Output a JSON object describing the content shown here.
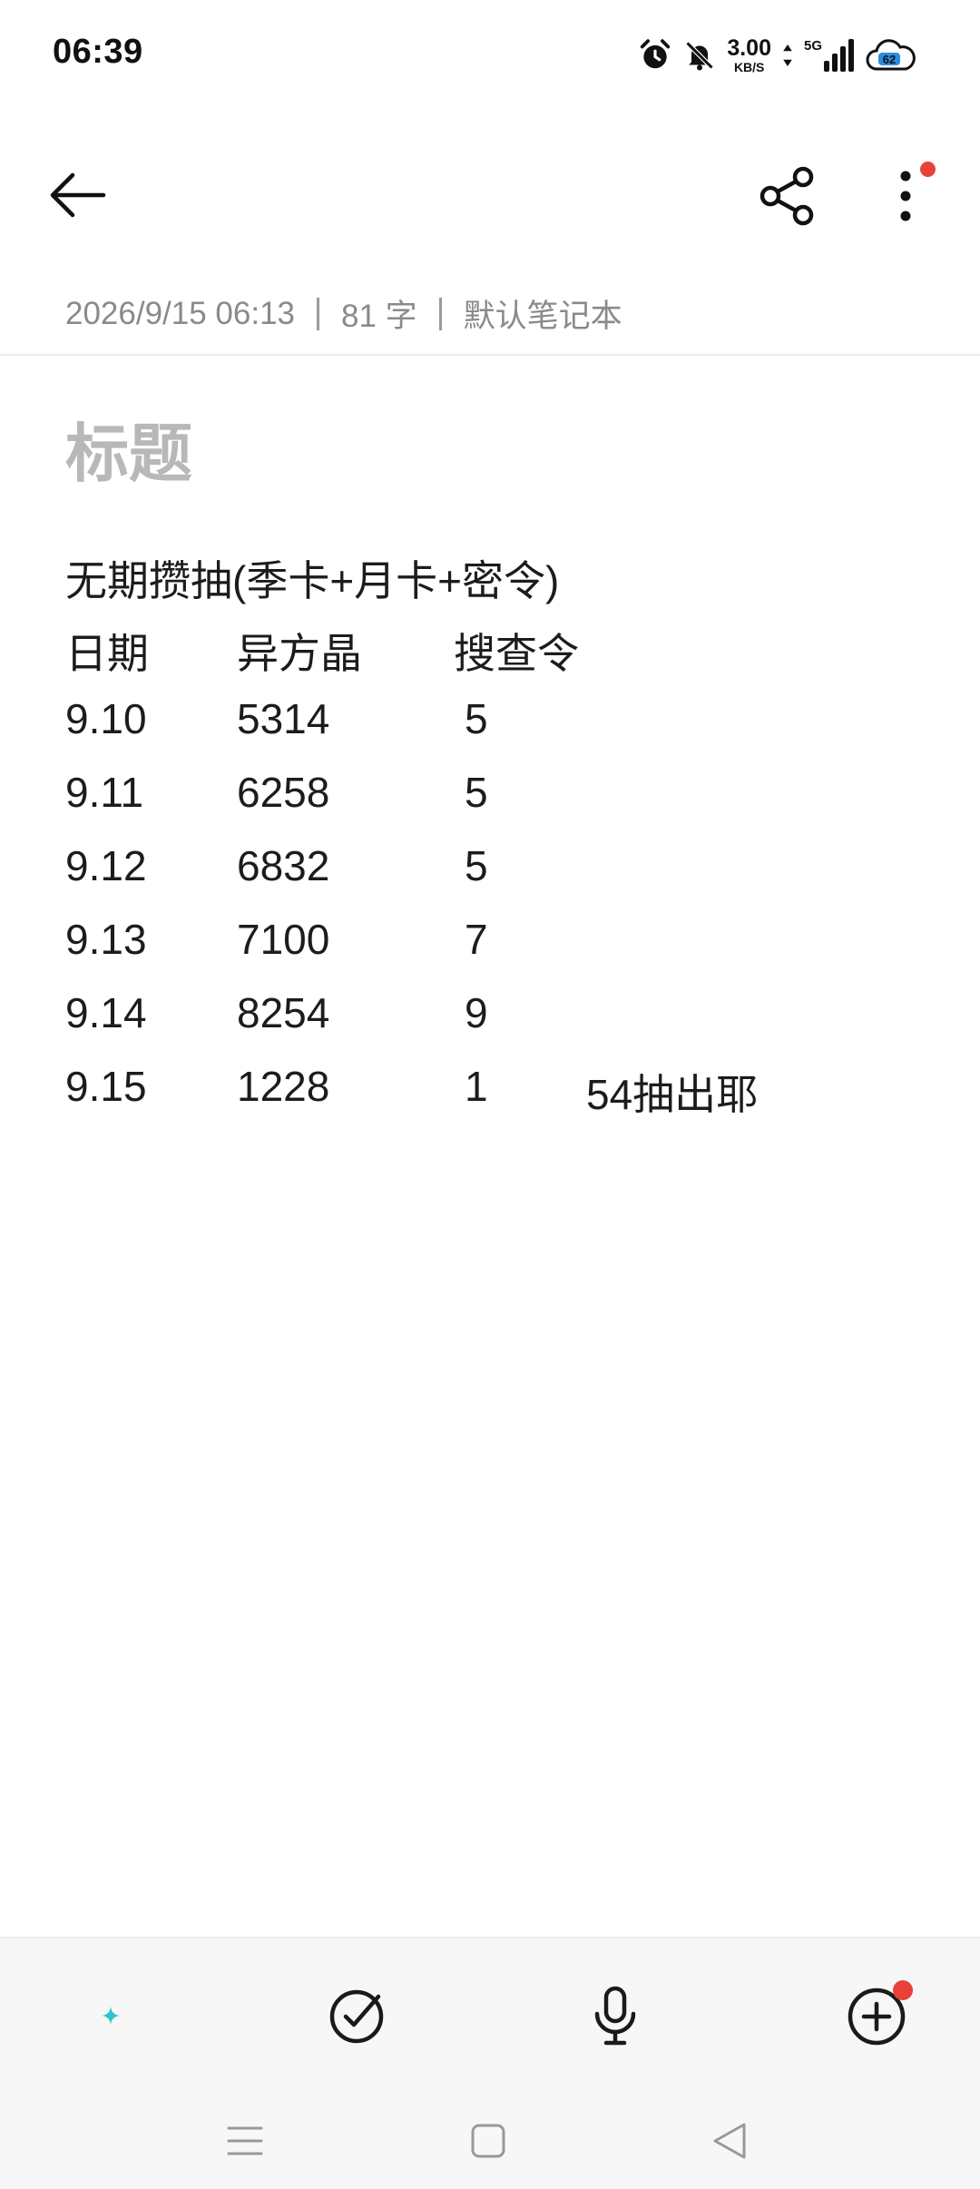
{
  "status_bar": {
    "time": "06:39",
    "net_speed_value": "3.00",
    "net_speed_unit": "KB/S",
    "network_type": "5G",
    "battery_level": "62",
    "icons": [
      "alarm-icon",
      "mute-bell-icon",
      "data-arrows-icon",
      "signal-icon",
      "cloud-battery-icon"
    ]
  },
  "top_bar": {
    "icons": [
      "back-arrow-icon",
      "share-icon",
      "more-vertical-icon"
    ],
    "more_badge_color": "#e8413a"
  },
  "meta": {
    "datetime": "2026/9/15 06:13",
    "word_count": "81 字",
    "notebook": "默认笔记本"
  },
  "note": {
    "title_placeholder": "标题",
    "heading": "无期攒抽(季卡+月卡+密令)",
    "table": {
      "headers": [
        "日期",
        "异方晶",
        "搜查令"
      ],
      "rows": [
        {
          "date": "9.10",
          "crystal": "5314",
          "token": "5",
          "note": ""
        },
        {
          "date": "9.11",
          "crystal": "6258",
          "token": "5",
          "note": ""
        },
        {
          "date": "9.12",
          "crystal": "6832",
          "token": "5",
          "note": ""
        },
        {
          "date": "9.13",
          "crystal": "7100",
          "token": "7",
          "note": ""
        },
        {
          "date": "9.14",
          "crystal": "8254",
          "token": "9",
          "note": ""
        },
        {
          "date": "9.15",
          "crystal": "1228",
          "token": "1",
          "note": "54抽出耶"
        }
      ]
    }
  },
  "toolbar": {
    "icons": [
      "ai-format-icon",
      "checklist-icon",
      "microphone-icon",
      "add-circle-icon"
    ],
    "add_badge_color": "#e8413a"
  },
  "nav_bar": {
    "icons": [
      "menu-icon",
      "home-icon",
      "back-triangle-icon"
    ]
  }
}
